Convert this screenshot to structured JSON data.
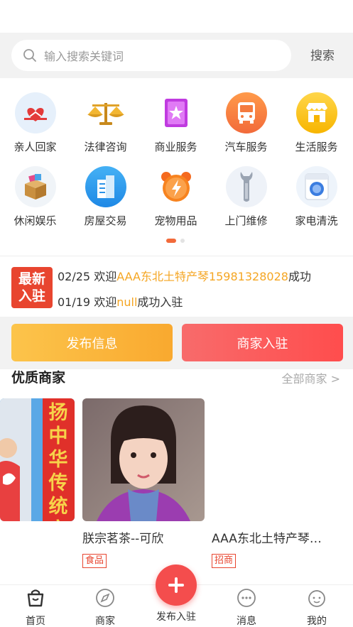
{
  "search": {
    "placeholder": "输入搜索关键词",
    "button": "搜索"
  },
  "categories": [
    {
      "label": "亲人回家",
      "icon": "hearts-home-icon"
    },
    {
      "label": "法律咨询",
      "icon": "scales-icon"
    },
    {
      "label": "商业服务",
      "icon": "star-card-icon"
    },
    {
      "label": "汽车服务",
      "icon": "bus-icon"
    },
    {
      "label": "生活服务",
      "icon": "shop-icon"
    },
    {
      "label": "休闲娱乐",
      "icon": "gift-box-icon"
    },
    {
      "label": "房屋交易",
      "icon": "building-icon"
    },
    {
      "label": "宠物用品",
      "icon": "alarm-clock-icon"
    },
    {
      "label": "上门维修",
      "icon": "wrench-icon"
    },
    {
      "label": "家电清洗",
      "icon": "washing-machine-icon"
    }
  ],
  "news": {
    "badge_line1": "最新",
    "badge_line2": "入驻",
    "items": [
      {
        "date": "02/25",
        "prefix": "欢迎",
        "name": "AAA东北土特产琴15981328028",
        "suffix": "成功"
      },
      {
        "date": "01/19",
        "prefix": "欢迎",
        "name": "null",
        "suffix": "成功入驻"
      }
    ]
  },
  "actions": {
    "publish": "发布信息",
    "join": "商家入驻"
  },
  "merchants": {
    "title": "优质商家",
    "more": "全部商家 >",
    "items": [
      {
        "name": "朕宗茗茶--可欣",
        "tag": "食品"
      },
      {
        "name": "AAA东北土特产琴…",
        "tag": "招商"
      }
    ],
    "banner_text": "扬中华传统文化"
  },
  "tabbar": {
    "home": "首页",
    "merchant": "商家",
    "publish": "发布入驻",
    "message": "消息",
    "mine": "我的"
  },
  "colors": {
    "accent": "#e8452f",
    "highlight": "#f5a623",
    "tab_active": "#333333"
  }
}
